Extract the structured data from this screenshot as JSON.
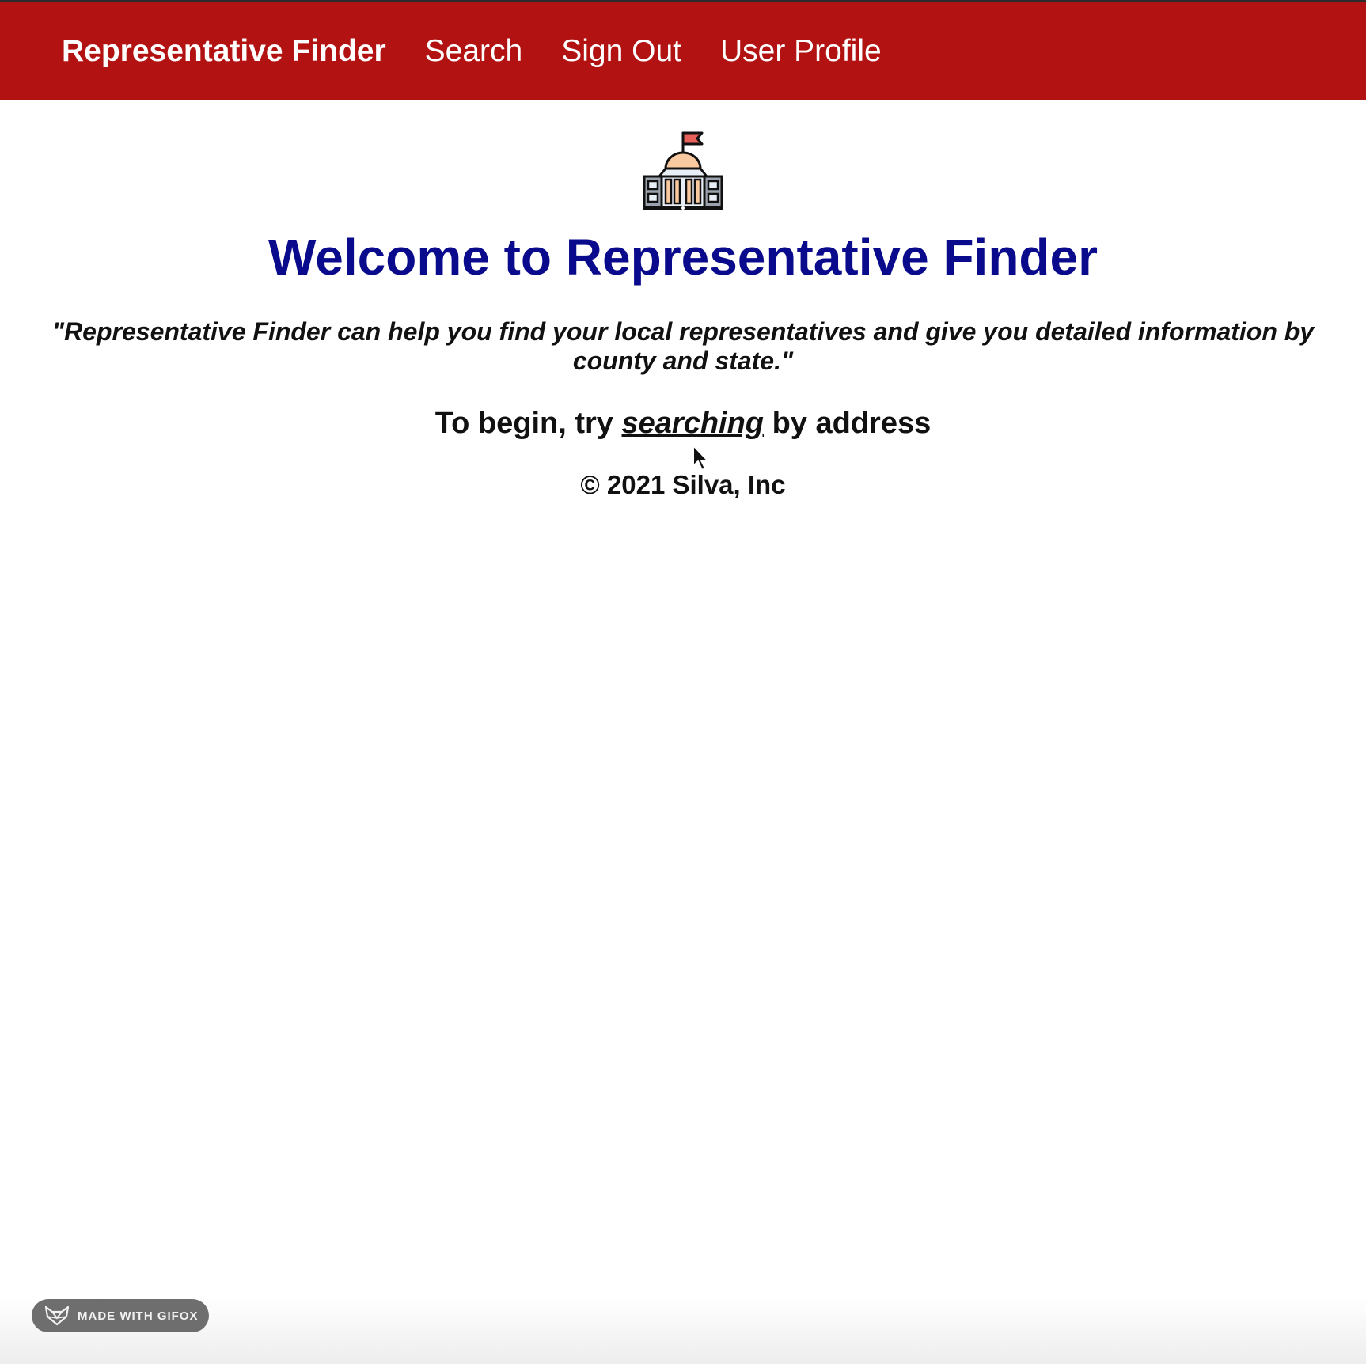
{
  "nav": {
    "brand": "Representative Finder",
    "links": [
      "Search",
      "Sign Out",
      "User Profile"
    ]
  },
  "hero": {
    "icon": "capitol-building-icon",
    "title": "Welcome to Representative Finder",
    "quote": "\"Representative Finder can help you find your local representatives and give you detailed information by county and state.\"",
    "begin_prefix": "To begin, try ",
    "begin_link": "searching",
    "begin_suffix": " by address",
    "copyright": "© 2021 Silva, Inc"
  },
  "badge": {
    "icon": "fox-icon",
    "label": "MADE WITH GIFOX"
  },
  "colors": {
    "navbar": "#b31212",
    "title": "#0a0a8c",
    "text": "#111111"
  }
}
